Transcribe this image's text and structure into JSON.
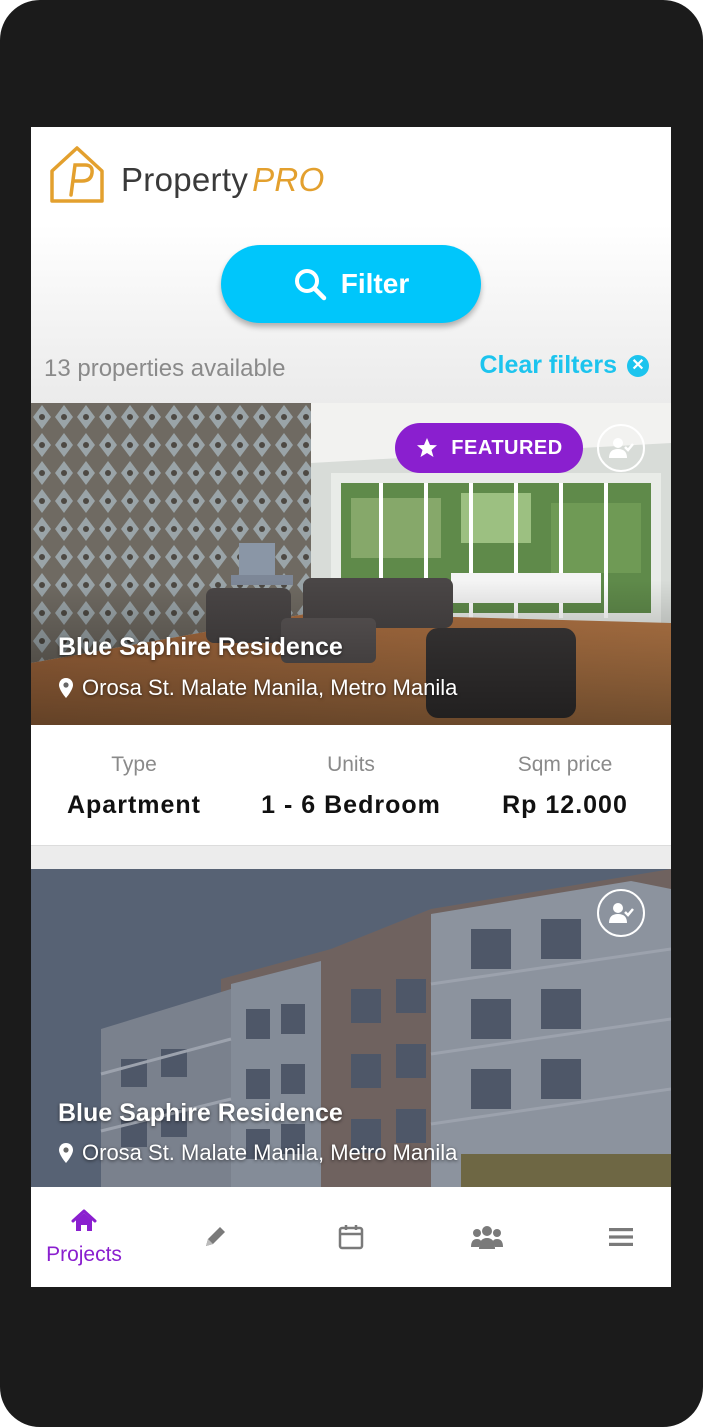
{
  "brand": {
    "name": "Property",
    "suffix": "PRO"
  },
  "filter": {
    "label": "Filter"
  },
  "results": {
    "count_text": "13 properties available",
    "clear_label": "Clear filters"
  },
  "listings": [
    {
      "featured": true,
      "badge": "FEATURED",
      "title": "Blue Saphire Residence",
      "address": "Orosa St. Malate Manila, Metro Manila",
      "info": {
        "type_label": "Type",
        "type_value": "Apartment",
        "units_label": "Units",
        "units_value": "1 - 6 Bedroom",
        "price_label": "Sqm price",
        "price_value": "Rp 12.000"
      }
    },
    {
      "featured": false,
      "title": "Blue Saphire Residence",
      "address": "Orosa St. Malate Manila, Metro Manila"
    }
  ],
  "nav": {
    "items": [
      {
        "icon": "home-icon",
        "label": "Projects",
        "active": true
      },
      {
        "icon": "pencil-icon",
        "label": ""
      },
      {
        "icon": "calendar-icon",
        "label": ""
      },
      {
        "icon": "users-icon",
        "label": ""
      },
      {
        "icon": "menu-icon",
        "label": ""
      }
    ]
  },
  "colors": {
    "accent": "#8a1fcf",
    "filter": "#00c6fb",
    "brand_orange": "#e3a02e",
    "clear": "#1cc4ee"
  }
}
